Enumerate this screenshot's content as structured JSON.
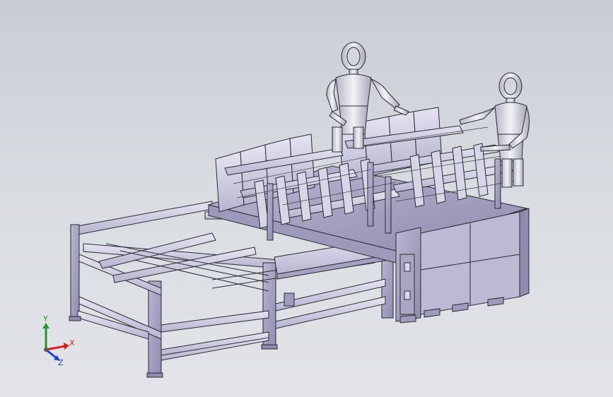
{
  "viewport": {
    "background_top": "#c9ccd3",
    "background_bottom": "#e2e4e8",
    "model_fill": "#c8c6dc",
    "model_fill_dark": "#a9a6c4",
    "model_fill_light": "#e4e2f0",
    "edge_color": "#2a2a33"
  },
  "triad": {
    "x_label": "X",
    "y_label": "Y",
    "z_label": "Z",
    "x_color": "#d9201c",
    "y_color": "#1f9a2b",
    "z_color": "#1f3fd6"
  },
  "model": {
    "components": [
      "conveyor-frame",
      "rack-assembly",
      "control-cabinet",
      "operator-left",
      "operator-right"
    ]
  }
}
